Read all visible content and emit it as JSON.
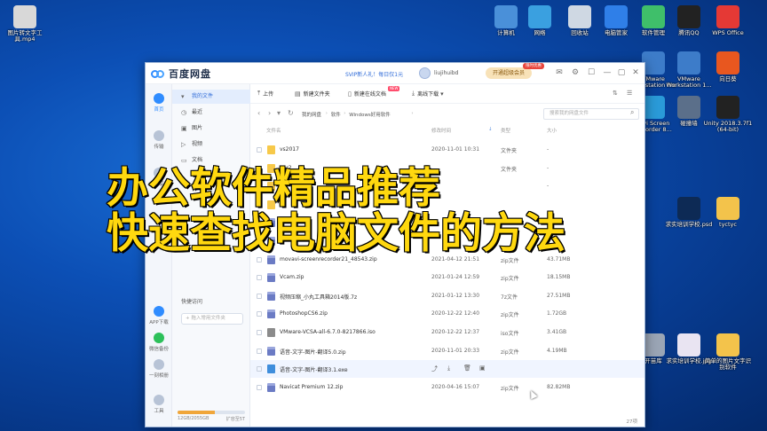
{
  "desktop": {
    "icons": [
      {
        "label": "图片转文字工具.mp4",
        "icon": "video-file-icon",
        "color": "#d8d8d8"
      },
      {
        "label": "计算机",
        "icon": "computer-icon",
        "color": "#4a90d9"
      },
      {
        "label": "网络",
        "icon": "network-icon",
        "color": "#3aa0e0"
      },
      {
        "label": "回收站",
        "icon": "recycle-bin-icon",
        "color": "#cfd8e3"
      },
      {
        "label": "电脑管家",
        "icon": "pc-manager-icon",
        "color": "#2f7fe8"
      },
      {
        "label": "软件管理",
        "icon": "software-manager-icon",
        "color": "#3fbf6a"
      },
      {
        "label": "腾讯QQ",
        "icon": "qq-icon",
        "color": "#222222"
      },
      {
        "label": "WPS Office",
        "icon": "wps-icon",
        "color": "#e53935"
      },
      {
        "label": "VMware Workstation Pro",
        "icon": "vmware-icon",
        "color": "#3d7cc9"
      },
      {
        "label": "VMware Workstation 1...",
        "icon": "vmware-icon",
        "color": "#3d7cc9"
      },
      {
        "label": "向日葵",
        "icon": "sunflower-icon",
        "color": "#e8571f"
      },
      {
        "label": "ravi Screen Recorder 8...",
        "icon": "recorder-icon",
        "color": "#2a9ad8"
      },
      {
        "label": "碰撞墙",
        "icon": "app-icon",
        "color": "#5b6f8a"
      },
      {
        "label": "Unity 2018.3.7f1 (64-bit)",
        "icon": "unity-icon",
        "color": "#222222"
      },
      {
        "label": "求实培训学校.psd",
        "icon": "psd-file-icon",
        "color": "#0d2a55"
      },
      {
        "label": "tyctyc",
        "icon": "folder-icon",
        "color": "#f3c34b"
      },
      {
        "label": "开苗库",
        "icon": "app-icon",
        "color": "#9aa5b5"
      },
      {
        "label": "求实培训学校.jpg",
        "icon": "jpg-file-icon",
        "color": "#e9e4f2"
      },
      {
        "label": "简单的图片文字识别软件",
        "icon": "folder-icon",
        "color": "#f3c34b"
      }
    ]
  },
  "window": {
    "app_name": "百度网盘",
    "svip_promo": "SVIP新人礼！每日仅1元",
    "username": "liujihuibd",
    "vip_button": "开通超级会员",
    "vip_badge": "限时优惠",
    "toolbar": {
      "upload": "上传",
      "new_folder": "新建文件夹",
      "new_online_doc": "新建在线文档",
      "new_tag": "NEW",
      "offline_download": "离线下载"
    },
    "rail": {
      "home": "首页",
      "transfer": "传输",
      "share": "分享",
      "app_download": "APP下载",
      "wechat_backup": "微信备份",
      "one_click_clean": "一刻相册",
      "tools": "工具"
    },
    "sidebar": {
      "my_files": "我的文件",
      "recent": "最近",
      "images": "图片",
      "videos": "视频",
      "docs": "文档",
      "quick_access": "快捷访问",
      "quick_access_placeholder": "+ 拖入常用文件夹",
      "quota_text": "12GB/2055GB",
      "quota_expand": "扩容至5T",
      "quota_fraction": 0.55
    },
    "path": {
      "crumbs": [
        "我的网盘",
        "软件",
        "Windows好用软件"
      ],
      "search_placeholder": "搜索我的网盘文件"
    },
    "table": {
      "headers": {
        "name": "文件名",
        "date": "修改时间",
        "type": "类型",
        "size": "大小"
      },
      "rows": [
        {
          "name": "vs2017",
          "date": "2020-11-01 10:31",
          "type": "文件夹",
          "size": "-",
          "kind": "folder"
        },
        {
          "name": "ver2",
          "date": "",
          "type": "文件夹",
          "size": "-",
          "kind": "folder"
        },
        {
          "name": "Tr",
          "date": "",
          "type": "",
          "size": "-",
          "kind": "folder"
        },
        {
          "name": "",
          "date": "",
          "type": "",
          "size": "",
          "kind": "folder"
        },
        {
          "name": "",
          "date": "",
          "type": "rar",
          "size": "",
          "kind": "zip"
        },
        {
          "name": "",
          "date": "",
          "type": "",
          "size": "",
          "kind": "zip"
        },
        {
          "name": "movavi-screenrecorder21_48543.zip",
          "date": "2021-04-12 21:51",
          "type": "zip文件",
          "size": "43.71MB",
          "kind": "zip"
        },
        {
          "name": "Vcam.zip",
          "date": "2021-01-24 12:59",
          "type": "zip文件",
          "size": "18.15MB",
          "kind": "zip"
        },
        {
          "name": "视频压缩_小丸工具箱2014版.7z",
          "date": "2021-01-12 13:30",
          "type": "7z文件",
          "size": "27.51MB",
          "kind": "zip"
        },
        {
          "name": "PhotoshopCS6.zip",
          "date": "2020-12-22 12:40",
          "type": "zip文件",
          "size": "1.72GB",
          "kind": "zip"
        },
        {
          "name": "VMware-VCSA-all-6.7.0-8217866.iso",
          "date": "2020-12-22 12:37",
          "type": "iso文件",
          "size": "3.41GB",
          "kind": "iso"
        },
        {
          "name": "语音-文字-图片-翻译5.0.zip",
          "date": "2020-11-01 20:33",
          "type": "zip文件",
          "size": "4.19MB",
          "kind": "zip"
        },
        {
          "name": "语音-文字-图片-翻译3.1.exe",
          "date": "",
          "type": "",
          "size": "",
          "kind": "exe"
        },
        {
          "name": "Navicat Premium 12.zip",
          "date": "2020-04-16 15:07",
          "type": "zip文件",
          "size": "82.82MB",
          "kind": "zip"
        }
      ],
      "item_count": "27项"
    }
  },
  "overlay": {
    "line1": "办公软件精品推荐",
    "line2": "快速查找电脑文件的方法"
  }
}
